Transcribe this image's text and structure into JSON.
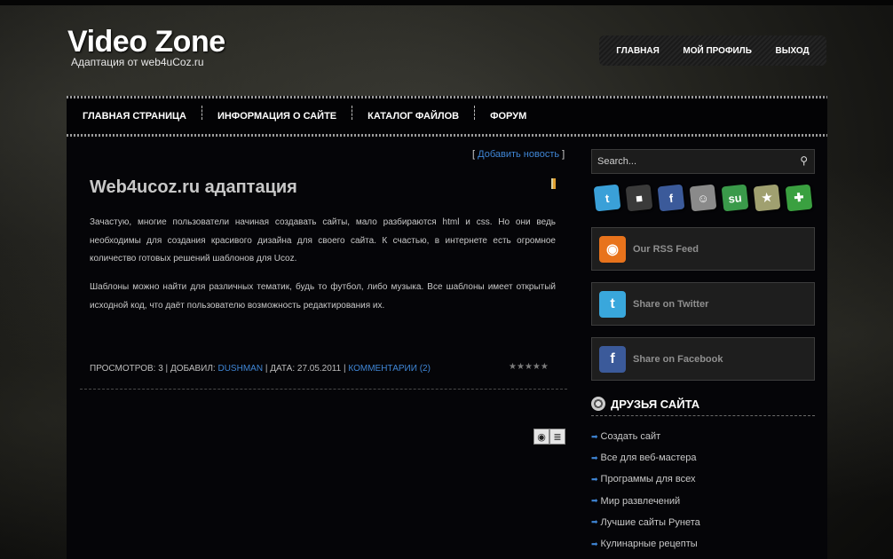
{
  "site": {
    "title": "Video Zone",
    "tagline": "Адаптация от web4uCoz.ru"
  },
  "topnav": [
    "ГЛАВНАЯ",
    "МОЙ ПРОФИЛЬ",
    "ВЫХОД"
  ],
  "menu": [
    "ГЛАВНАЯ СТРАНИЦА",
    "ИНФОРМАЦИЯ О САЙТЕ",
    "КАТАЛОГ ФАЙЛОВ",
    "ФОРУМ"
  ],
  "add_news": {
    "open": "[",
    "label": "Добавить новость",
    "close": "]"
  },
  "post": {
    "title": "Web4ucoz.ru адаптация",
    "paragraphs": [
      "Зачастую, многие пользователи начиная создавать сайты, мало разбираются html и css. Но они ведь необходимы для создания красивого дизайна для своего сайта. К счастью, в интернете есть огромное количество готовых решений шаблонов для Ucoz.",
      "Шаблоны можно найти для различных тематик, будь то футбол, либо музыка. Все шаблоны имеет открытый исходной код, что даёт пользователю возможность редактирования их."
    ],
    "meta": {
      "views_label": "ПРОСМОТРОВ: 3",
      "sep": "|",
      "author_label": "ДОБАВИЛ:",
      "author": "DUSHMAN",
      "date_label": "ДАТА: 27.05.2011",
      "comments": "КОММЕНТАРИИ (2)"
    },
    "rating": {
      "stars_total": 5,
      "stars_filled": 0
    }
  },
  "search": {
    "placeholder": "Search..."
  },
  "social_icons": [
    {
      "icon": "twitter-icon",
      "glyph": "t",
      "color": "#3aa0d8"
    },
    {
      "icon": "delicious-icon",
      "glyph": "■",
      "color": "#3a3a3a"
    },
    {
      "icon": "facebook-icon",
      "glyph": "f",
      "color": "#3b5a9a"
    },
    {
      "icon": "myspace-icon",
      "glyph": "☺",
      "color": "#8a8a8a"
    },
    {
      "icon": "stumbleupon-icon",
      "glyph": "su",
      "color": "#3a9a4a"
    },
    {
      "icon": "favorites-icon",
      "glyph": "★",
      "color": "#a0a070"
    },
    {
      "icon": "bookmark-plus-icon",
      "glyph": "✚",
      "color": "#3aa040"
    }
  ],
  "widgets": [
    {
      "label": "Our RSS Feed",
      "icon": "rss-icon",
      "glyph": "◉",
      "color": "#e8731c"
    },
    {
      "label": "Share on Twitter",
      "icon": "twitter-icon",
      "glyph": "t",
      "color": "#39a7dc"
    },
    {
      "label": "Share on Facebook",
      "icon": "facebook-icon",
      "glyph": "f",
      "color": "#3b5a9a"
    }
  ],
  "friends": {
    "title": "ДРУЗЬЯ САЙТА",
    "items": [
      "Создать сайт",
      "Все для веб-мастера",
      "Программы для всех",
      "Мир развлечений",
      "Лучшие сайты Рунета",
      "Кулинарные рецепты"
    ]
  }
}
